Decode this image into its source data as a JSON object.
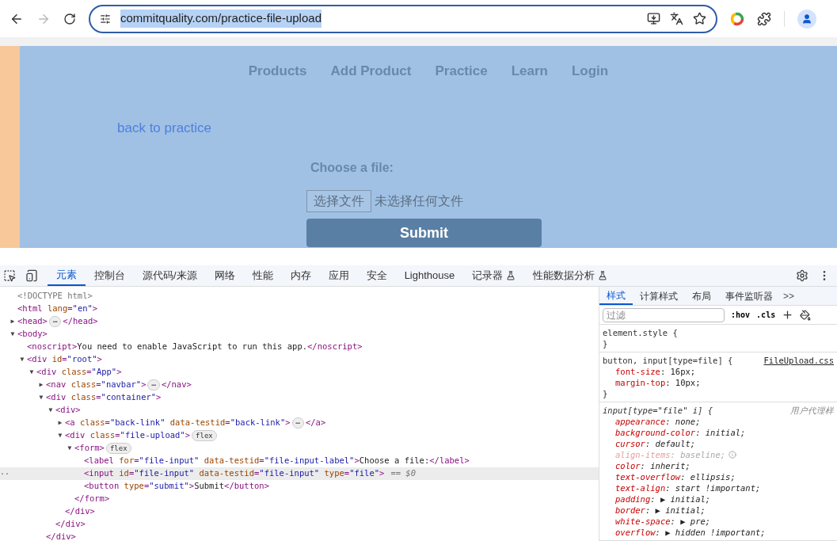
{
  "browser": {
    "url": "commitquality.com/practice-file-upload"
  },
  "page": {
    "nav": [
      "Products",
      "Add Product",
      "Practice",
      "Learn",
      "Login"
    ],
    "back_link": "back to practice",
    "label": "Choose a file:",
    "file_button": "选择文件",
    "file_status": "未选择任何文件",
    "submit": "Submit"
  },
  "devtools": {
    "tabs": [
      {
        "label": "元素",
        "selected": true,
        "beaker": false
      },
      {
        "label": "控制台",
        "selected": false,
        "beaker": false
      },
      {
        "label": "源代码/来源",
        "selected": false,
        "beaker": false
      },
      {
        "label": "网络",
        "selected": false,
        "beaker": false
      },
      {
        "label": "性能",
        "selected": false,
        "beaker": false
      },
      {
        "label": "内存",
        "selected": false,
        "beaker": false
      },
      {
        "label": "应用",
        "selected": false,
        "beaker": false
      },
      {
        "label": "安全",
        "selected": false,
        "beaker": false
      },
      {
        "label": "Lighthouse",
        "selected": false,
        "beaker": false
      },
      {
        "label": "记录器",
        "selected": false,
        "beaker": true
      },
      {
        "label": "性能数据分析",
        "selected": false,
        "beaker": true
      }
    ],
    "dom": [
      {
        "text": "<!DOCTYPE html>",
        "kind": "doctype",
        "selected": false
      },
      {
        "text": "<html lang=\"en\">",
        "selected": false
      },
      {
        "toggle": "▶",
        "text": "<head>",
        "badge": "⋯",
        "tail": "</head>",
        "selected": false
      },
      {
        "toggle": "▼",
        "text": "<body>",
        "selected": false,
        "children": [
          {
            "text": "<noscript>You need to enable JavaScript to run this app.</noscript>",
            "selected": false
          },
          {
            "toggle": "▼",
            "text": "<div id=\"root\">",
            "selected": false,
            "children": [
              {
                "toggle": "▼",
                "text": "<div class=\"App\">",
                "selected": false,
                "children": [
                  {
                    "toggle": "▶",
                    "text": "<nav class=\"navbar\">",
                    "badge": "⋯",
                    "tail": "</nav>",
                    "selected": false
                  },
                  {
                    "toggle": "▼",
                    "text": "<div class=\"container\">",
                    "selected": false,
                    "children": [
                      {
                        "toggle": "▼",
                        "text": "<div>",
                        "selected": false,
                        "children": [
                          {
                            "toggle": "▶",
                            "text": "<a class=\"back-link\" data-testid=\"back-link\">",
                            "badge": "⋯",
                            "tail": "</a>",
                            "selected": false
                          },
                          {
                            "toggle": "▼",
                            "text": "<div class=\"file-upload\">",
                            "badge": "flex",
                            "selected": false,
                            "children": [
                              {
                                "toggle": "▼",
                                "text": "<form>",
                                "badge": "flex",
                                "selected": false,
                                "children": [
                                  {
                                    "text": "<label for=\"file-input\" data-testid=\"file-input-label\">Choose a file:</label>",
                                    "selected": false
                                  },
                                  {
                                    "marker": "··",
                                    "text": "<input id=\"file-input\" data-testid=\"file-input\" type=\"file\">",
                                    "suffix": "== $0",
                                    "selected": true
                                  },
                                  {
                                    "text": "<button type=\"submit\">Submit</button>",
                                    "selected": false
                                  }
                                ]
                              },
                              {
                                "text": "</form>",
                                "selected": false
                              }
                            ]
                          },
                          {
                            "text": "</div>",
                            "selected": false
                          }
                        ]
                      },
                      {
                        "text": "</div>",
                        "selected": false
                      }
                    ]
                  },
                  {
                    "text": "</div>",
                    "selected": false
                  }
                ]
              }
            ]
          }
        ]
      }
    ],
    "side_tabs": [
      {
        "label": "样式",
        "selected": true
      },
      {
        "label": "计算样式",
        "selected": false
      },
      {
        "label": "布局",
        "selected": false
      },
      {
        "label": "事件监听器",
        "selected": false
      }
    ],
    "more": ">>",
    "filter_placeholder": "过滤",
    "hov": ":hov",
    "cls": ".cls",
    "rules": [
      {
        "selector": "element.style {",
        "close": "}",
        "italic": false
      },
      {
        "selector": "button, input[type=file] {",
        "source": "FileUpload.css",
        "close": "}",
        "italic": false,
        "declarations": [
          {
            "text": "font-size: 16px;",
            "disabled": false
          },
          {
            "text": "margin-top: 10px;",
            "disabled": false
          }
        ]
      },
      {
        "selector": "input[type=\"file\" i] {",
        "source": "用户代理样",
        "italic": true,
        "declarations": [
          {
            "text": "appearance: none;",
            "disabled": false
          },
          {
            "text": "background-color: initial;",
            "disabled": false
          },
          {
            "text": "cursor: default;",
            "disabled": false
          },
          {
            "text": "align-items: baseline;",
            "disabled": true
          },
          {
            "text": "color: inherit;",
            "disabled": false
          },
          {
            "text": "text-overflow: ellipsis;",
            "disabled": false
          },
          {
            "text": "text-align: start !important;",
            "disabled": false
          },
          {
            "text": "padding: ▶ initial;",
            "disabled": false
          },
          {
            "text": "border: ▶ initial;",
            "disabled": false
          },
          {
            "text": "white-space: ▶ pre;",
            "disabled": false
          },
          {
            "text": "overflow: ▶ hidden !important;",
            "disabled": false
          }
        ]
      }
    ]
  }
}
